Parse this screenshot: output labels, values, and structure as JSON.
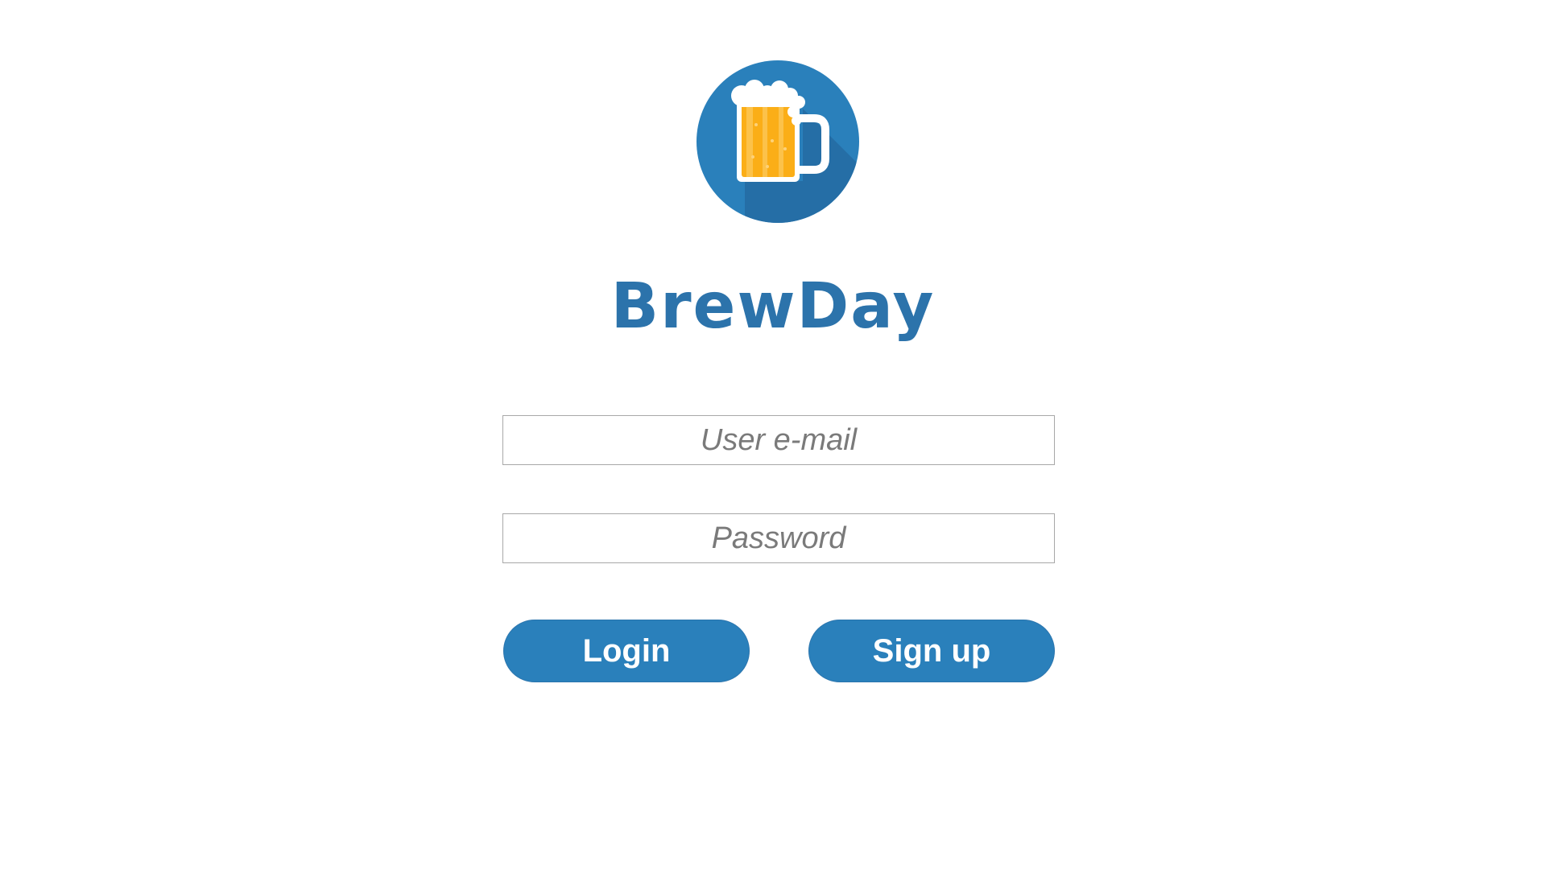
{
  "app": {
    "title": "BrewDay",
    "logo_icon": "beer-mug-icon"
  },
  "form": {
    "email_placeholder": "User e-mail",
    "email_value": "",
    "password_placeholder": "Password",
    "password_value": ""
  },
  "buttons": {
    "login_label": "Login",
    "signup_label": "Sign up"
  },
  "colors": {
    "brand": "#2a80bb",
    "title": "#2c73ab",
    "button_bg": "#2a80bb",
    "beer": "#fbae17",
    "foam": "#ffffff"
  }
}
